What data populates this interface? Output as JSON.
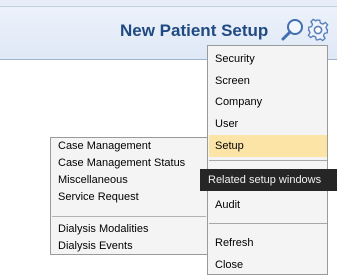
{
  "header": {
    "title": "New Patient Setup",
    "search_icon": "magnifier-icon",
    "settings_icon": "gear-icon",
    "accent": "#1f4a82"
  },
  "menu": {
    "items": [
      {
        "label": "Security"
      },
      {
        "label": "Screen"
      },
      {
        "label": "Company"
      },
      {
        "label": "User"
      },
      {
        "label": "Setup",
        "selected": true
      },
      {
        "label": "Audit"
      },
      {
        "label": "Refresh"
      },
      {
        "label": "Close"
      }
    ],
    "highlight_color": "#fbe4a6"
  },
  "tooltip": {
    "text": "Related setup windows"
  },
  "submenu": {
    "items": [
      {
        "label": "Case Management"
      },
      {
        "label": "Case Management Status"
      },
      {
        "label": "Miscellaneous"
      },
      {
        "label": "Service Request"
      },
      {
        "label": "Dialysis Modalities"
      },
      {
        "label": "Dialysis Events"
      }
    ]
  }
}
